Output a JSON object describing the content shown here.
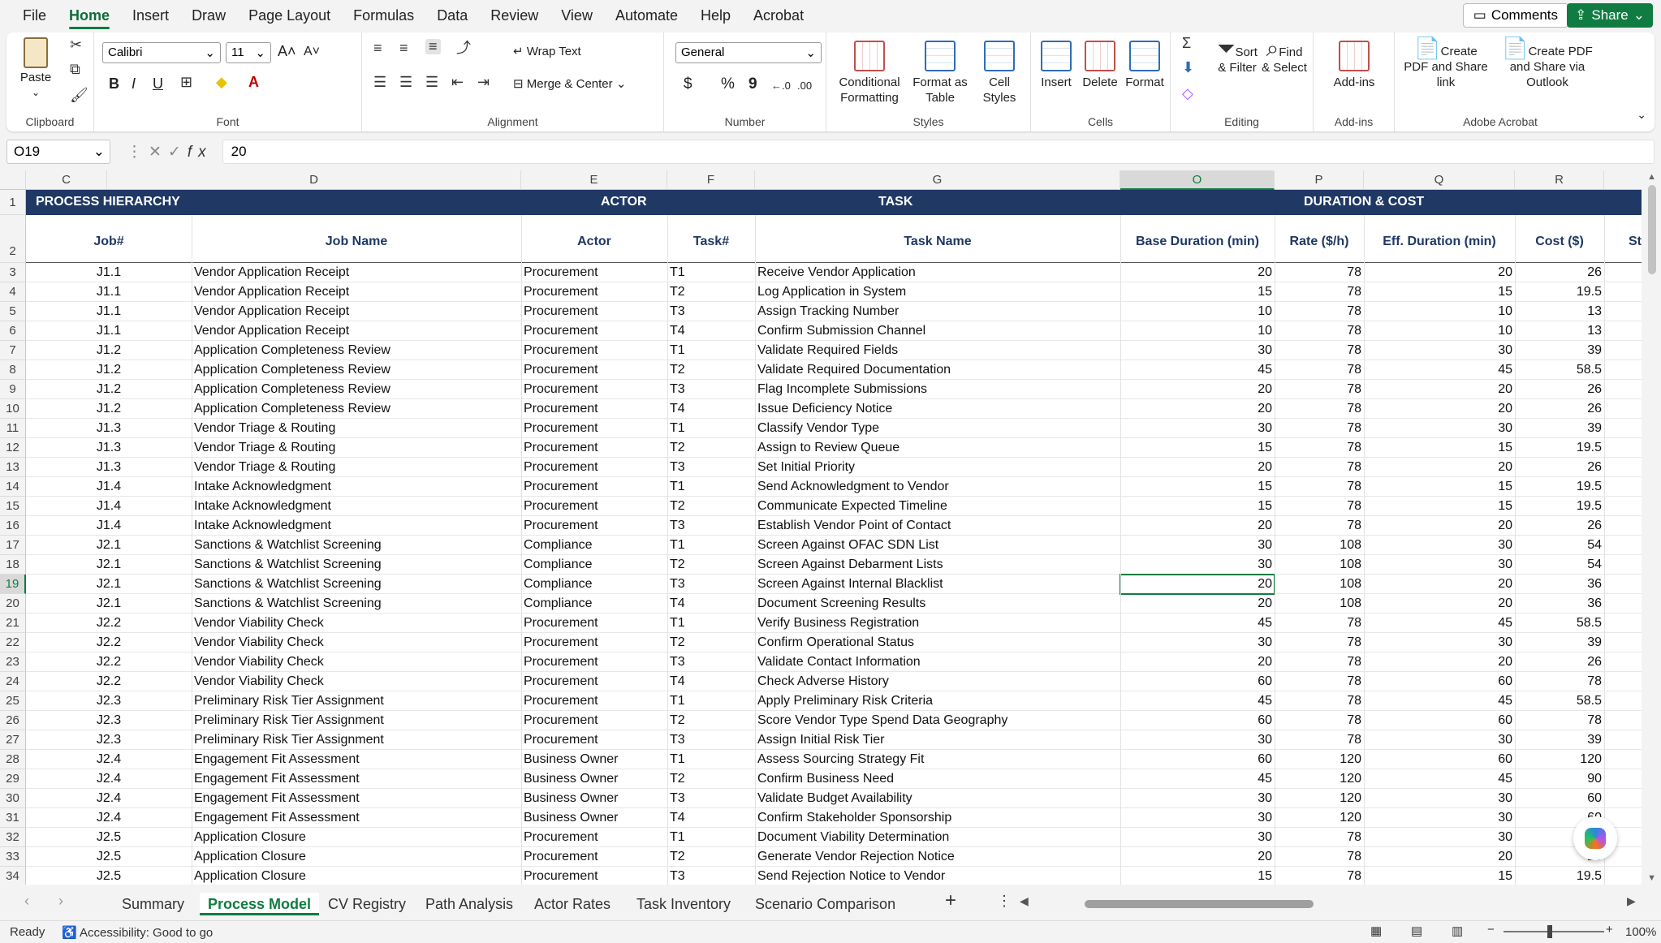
{
  "menu": {
    "tabs": [
      "File",
      "Home",
      "Insert",
      "Draw",
      "Page Layout",
      "Formulas",
      "Data",
      "Review",
      "View",
      "Automate",
      "Help",
      "Acrobat"
    ],
    "active": "Home",
    "comments": "Comments",
    "share": "Share"
  },
  "ribbon": {
    "clipboard": {
      "label": "Clipboard",
      "paste": "Paste"
    },
    "font": {
      "label": "Font",
      "name": "Calibri",
      "size": "11",
      "bold": "B",
      "italic": "I",
      "underline": "U"
    },
    "alignment": {
      "label": "Alignment",
      "wrap": "Wrap Text",
      "merge": "Merge & Center"
    },
    "number": {
      "label": "Number",
      "format": "General",
      "currency": "$",
      "percent": "%",
      "comma": "9"
    },
    "styles": {
      "label": "Styles",
      "conditional": "Conditional Formatting",
      "format_table": "Format as Table",
      "cell_styles": "Cell Styles"
    },
    "cells": {
      "label": "Cells",
      "insert": "Insert",
      "delete": "Delete",
      "format": "Format"
    },
    "editing": {
      "label": "Editing",
      "sort": "Sort & Filter",
      "find": "Find & Select"
    },
    "addins": {
      "label": "Add-ins",
      "addins": "Add-ins"
    },
    "acrobat": {
      "label": "Adobe Acrobat",
      "pdf_share": "Create PDF and Share link",
      "pdf_outlook": "Create PDF and Share via Outlook"
    }
  },
  "formula_bar": {
    "name_box": "O19",
    "value": "20"
  },
  "columns": [
    "C",
    "D",
    "E",
    "F",
    "G",
    "O",
    "P",
    "Q",
    "R"
  ],
  "banner": {
    "process": "PROCESS HIERARCHY",
    "actor": "ACTOR",
    "task": "TASK",
    "duration": "DURATION & COST"
  },
  "headers": {
    "job_num": "Job#",
    "job_name": "Job Name",
    "actor": "Actor",
    "task_num": "Task#",
    "task_name": "Task Name",
    "base": "Base Duration (min)",
    "rate": "Rate ($/h)",
    "eff": "Eff. Duration (min)",
    "cost": "Cost ($)",
    "st": "St"
  },
  "rows": [
    {
      "r": "3",
      "job": "J1.1",
      "name": "Vendor Application Receipt",
      "actor": "Procurement",
      "task": "T1",
      "tname": "Receive Vendor Application",
      "base": "20",
      "rate": "78",
      "eff": "20",
      "cost": "26"
    },
    {
      "r": "4",
      "job": "J1.1",
      "name": "Vendor Application Receipt",
      "actor": "Procurement",
      "task": "T2",
      "tname": "Log Application in System",
      "base": "15",
      "rate": "78",
      "eff": "15",
      "cost": "19.5"
    },
    {
      "r": "5",
      "job": "J1.1",
      "name": "Vendor Application Receipt",
      "actor": "Procurement",
      "task": "T3",
      "tname": "Assign Tracking Number",
      "base": "10",
      "rate": "78",
      "eff": "10",
      "cost": "13"
    },
    {
      "r": "6",
      "job": "J1.1",
      "name": "Vendor Application Receipt",
      "actor": "Procurement",
      "task": "T4",
      "tname": "Confirm Submission Channel",
      "base": "10",
      "rate": "78",
      "eff": "10",
      "cost": "13"
    },
    {
      "r": "7",
      "job": "J1.2",
      "name": "Application Completeness Review",
      "actor": "Procurement",
      "task": "T1",
      "tname": "Validate Required Fields",
      "base": "30",
      "rate": "78",
      "eff": "30",
      "cost": "39"
    },
    {
      "r": "8",
      "job": "J1.2",
      "name": "Application Completeness Review",
      "actor": "Procurement",
      "task": "T2",
      "tname": "Validate Required Documentation",
      "base": "45",
      "rate": "78",
      "eff": "45",
      "cost": "58.5"
    },
    {
      "r": "9",
      "job": "J1.2",
      "name": "Application Completeness Review",
      "actor": "Procurement",
      "task": "T3",
      "tname": "Flag Incomplete Submissions",
      "base": "20",
      "rate": "78",
      "eff": "20",
      "cost": "26"
    },
    {
      "r": "10",
      "job": "J1.2",
      "name": "Application Completeness Review",
      "actor": "Procurement",
      "task": "T4",
      "tname": "Issue Deficiency Notice",
      "base": "20",
      "rate": "78",
      "eff": "20",
      "cost": "26"
    },
    {
      "r": "11",
      "job": "J1.3",
      "name": "Vendor Triage & Routing",
      "actor": "Procurement",
      "task": "T1",
      "tname": "Classify Vendor Type",
      "base": "30",
      "rate": "78",
      "eff": "30",
      "cost": "39"
    },
    {
      "r": "12",
      "job": "J1.3",
      "name": "Vendor Triage & Routing",
      "actor": "Procurement",
      "task": "T2",
      "tname": "Assign to Review Queue",
      "base": "15",
      "rate": "78",
      "eff": "15",
      "cost": "19.5"
    },
    {
      "r": "13",
      "job": "J1.3",
      "name": "Vendor Triage & Routing",
      "actor": "Procurement",
      "task": "T3",
      "tname": "Set Initial Priority",
      "base": "20",
      "rate": "78",
      "eff": "20",
      "cost": "26"
    },
    {
      "r": "14",
      "job": "J1.4",
      "name": "Intake Acknowledgment",
      "actor": "Procurement",
      "task": "T1",
      "tname": "Send Acknowledgment to Vendor",
      "base": "15",
      "rate": "78",
      "eff": "15",
      "cost": "19.5"
    },
    {
      "r": "15",
      "job": "J1.4",
      "name": "Intake Acknowledgment",
      "actor": "Procurement",
      "task": "T2",
      "tname": "Communicate Expected Timeline",
      "base": "15",
      "rate": "78",
      "eff": "15",
      "cost": "19.5"
    },
    {
      "r": "16",
      "job": "J1.4",
      "name": "Intake Acknowledgment",
      "actor": "Procurement",
      "task": "T3",
      "tname": "Establish Vendor Point of Contact",
      "base": "20",
      "rate": "78",
      "eff": "20",
      "cost": "26"
    },
    {
      "r": "17",
      "job": "J2.1",
      "name": "Sanctions & Watchlist Screening",
      "actor": "Compliance",
      "task": "T1",
      "tname": "Screen Against OFAC SDN List",
      "base": "30",
      "rate": "108",
      "eff": "30",
      "cost": "54"
    },
    {
      "r": "18",
      "job": "J2.1",
      "name": "Sanctions & Watchlist Screening",
      "actor": "Compliance",
      "task": "T2",
      "tname": "Screen Against Debarment Lists",
      "base": "30",
      "rate": "108",
      "eff": "30",
      "cost": "54"
    },
    {
      "r": "19",
      "job": "J2.1",
      "name": "Sanctions & Watchlist Screening",
      "actor": "Compliance",
      "task": "T3",
      "tname": "Screen Against Internal Blacklist",
      "base": "20",
      "rate": "108",
      "eff": "20",
      "cost": "36"
    },
    {
      "r": "20",
      "job": "J2.1",
      "name": "Sanctions & Watchlist Screening",
      "actor": "Compliance",
      "task": "T4",
      "tname": "Document Screening Results",
      "base": "20",
      "rate": "108",
      "eff": "20",
      "cost": "36"
    },
    {
      "r": "21",
      "job": "J2.2",
      "name": "Vendor Viability Check",
      "actor": "Procurement",
      "task": "T1",
      "tname": "Verify Business Registration",
      "base": "45",
      "rate": "78",
      "eff": "45",
      "cost": "58.5"
    },
    {
      "r": "22",
      "job": "J2.2",
      "name": "Vendor Viability Check",
      "actor": "Procurement",
      "task": "T2",
      "tname": "Confirm Operational Status",
      "base": "30",
      "rate": "78",
      "eff": "30",
      "cost": "39"
    },
    {
      "r": "23",
      "job": "J2.2",
      "name": "Vendor Viability Check",
      "actor": "Procurement",
      "task": "T3",
      "tname": "Validate Contact Information",
      "base": "20",
      "rate": "78",
      "eff": "20",
      "cost": "26"
    },
    {
      "r": "24",
      "job": "J2.2",
      "name": "Vendor Viability Check",
      "actor": "Procurement",
      "task": "T4",
      "tname": "Check Adverse History",
      "base": "60",
      "rate": "78",
      "eff": "60",
      "cost": "78"
    },
    {
      "r": "25",
      "job": "J2.3",
      "name": "Preliminary Risk Tier Assignment",
      "actor": "Procurement",
      "task": "T1",
      "tname": "Apply Preliminary Risk Criteria",
      "base": "45",
      "rate": "78",
      "eff": "45",
      "cost": "58.5"
    },
    {
      "r": "26",
      "job": "J2.3",
      "name": "Preliminary Risk Tier Assignment",
      "actor": "Procurement",
      "task": "T2",
      "tname": "Score Vendor Type Spend Data Geography",
      "base": "60",
      "rate": "78",
      "eff": "60",
      "cost": "78"
    },
    {
      "r": "27",
      "job": "J2.3",
      "name": "Preliminary Risk Tier Assignment",
      "actor": "Procurement",
      "task": "T3",
      "tname": "Assign Initial Risk Tier",
      "base": "30",
      "rate": "78",
      "eff": "30",
      "cost": "39"
    },
    {
      "r": "28",
      "job": "J2.4",
      "name": "Engagement Fit Assessment",
      "actor": "Business Owner",
      "task": "T1",
      "tname": "Assess Sourcing Strategy Fit",
      "base": "60",
      "rate": "120",
      "eff": "60",
      "cost": "120"
    },
    {
      "r": "29",
      "job": "J2.4",
      "name": "Engagement Fit Assessment",
      "actor": "Business Owner",
      "task": "T2",
      "tname": "Confirm Business Need",
      "base": "45",
      "rate": "120",
      "eff": "45",
      "cost": "90"
    },
    {
      "r": "30",
      "job": "J2.4",
      "name": "Engagement Fit Assessment",
      "actor": "Business Owner",
      "task": "T3",
      "tname": "Validate Budget Availability",
      "base": "30",
      "rate": "120",
      "eff": "30",
      "cost": "60"
    },
    {
      "r": "31",
      "job": "J2.4",
      "name": "Engagement Fit Assessment",
      "actor": "Business Owner",
      "task": "T4",
      "tname": "Confirm Stakeholder Sponsorship",
      "base": "30",
      "rate": "120",
      "eff": "30",
      "cost": "60"
    },
    {
      "r": "32",
      "job": "J2.5",
      "name": "Application Closure",
      "actor": "Procurement",
      "task": "T1",
      "tname": "Document Viability Determination",
      "base": "30",
      "rate": "78",
      "eff": "30",
      "cost": "39"
    },
    {
      "r": "33",
      "job": "J2.5",
      "name": "Application Closure",
      "actor": "Procurement",
      "task": "T2",
      "tname": "Generate Vendor Rejection Notice",
      "base": "20",
      "rate": "78",
      "eff": "20",
      "cost": "26"
    },
    {
      "r": "34",
      "job": "J2.5",
      "name": "Application Closure",
      "actor": "Procurement",
      "task": "T3",
      "tname": "Send Rejection Notice to Vendor",
      "base": "15",
      "rate": "78",
      "eff": "15",
      "cost": "19.5"
    }
  ],
  "sheets": [
    "Summary",
    "Process Model",
    "CV Registry",
    "Path Analysis",
    "Actor Rates",
    "Task Inventory",
    "Scenario Comparison"
  ],
  "active_sheet": "Process Model",
  "status": {
    "ready": "Ready",
    "accessibility": "Accessibility: Good to go",
    "zoom": "100%"
  },
  "colors": {
    "accent": "#107c41",
    "banner": "#1f3864"
  }
}
